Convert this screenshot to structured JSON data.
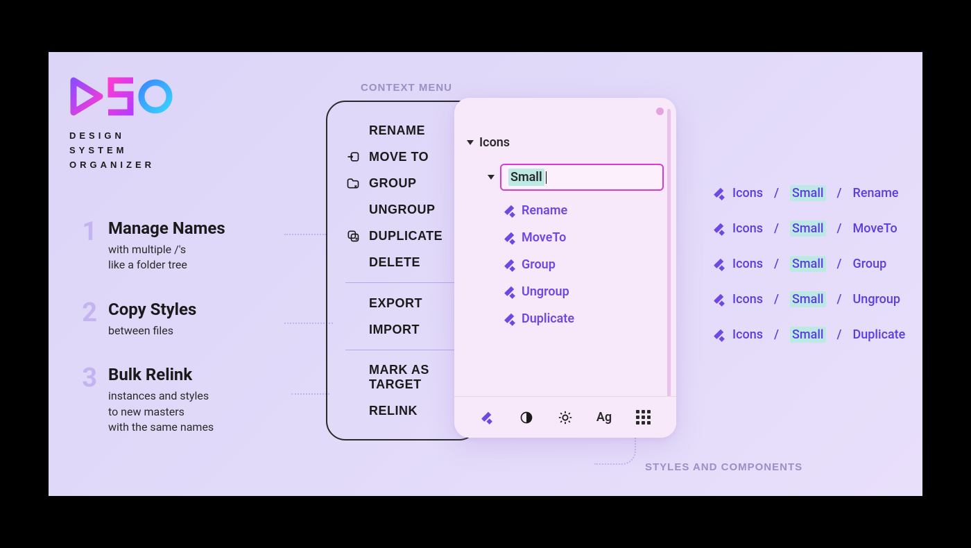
{
  "logo": {
    "line1": "DESIGN",
    "line2": "SYSTEM",
    "line3": "ORGANIZER"
  },
  "labels": {
    "context_menu": "CONTEXT MENU",
    "styles_components": "STYLES AND COMPONENTS"
  },
  "features": [
    {
      "num": "1",
      "title": "Manage Names",
      "desc": "with multiple /'s\nlike a folder tree"
    },
    {
      "num": "2",
      "title": "Copy Styles",
      "desc": "between files"
    },
    {
      "num": "3",
      "title": "Bulk Relink",
      "desc": "instances and styles\nto new masters\nwith the same names"
    }
  ],
  "context_menu": {
    "items_a": [
      {
        "label": "RENAME",
        "icon": null
      },
      {
        "label": "MOVE TO",
        "icon": "move-to-icon"
      },
      {
        "label": "GROUP",
        "icon": "group-icon"
      },
      {
        "label": "UNGROUP",
        "icon": null
      },
      {
        "label": "DUPLICATE",
        "icon": "duplicate-icon"
      },
      {
        "label": "DELETE",
        "icon": null
      }
    ],
    "items_b": [
      {
        "label": "EXPORT",
        "icon": null
      },
      {
        "label": "IMPORT",
        "icon": null
      }
    ],
    "items_c": [
      {
        "label": "MARK AS TARGET",
        "icon": null
      },
      {
        "label": "RELINK",
        "icon": null
      }
    ]
  },
  "tree": {
    "root": "Icons",
    "editing": "Small",
    "children": [
      "Rename",
      "MoveTo",
      "Group",
      "Ungroup",
      "Duplicate"
    ],
    "toolbar_ag": "Ag"
  },
  "paths": [
    {
      "a": "Icons",
      "b": "Small",
      "c": "Rename"
    },
    {
      "a": "Icons",
      "b": "Small",
      "c": "MoveTo"
    },
    {
      "a": "Icons",
      "b": "Small",
      "c": "Group"
    },
    {
      "a": "Icons",
      "b": "Small",
      "c": "Ungroup"
    },
    {
      "a": "Icons",
      "b": "Small",
      "c": "Duplicate"
    }
  ]
}
